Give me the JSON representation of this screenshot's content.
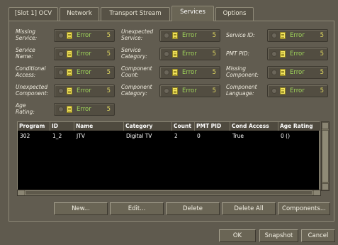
{
  "tabs": [
    {
      "label": "[Slot 1] OCV"
    },
    {
      "label": "Network"
    },
    {
      "label": "Transport Stream"
    },
    {
      "label": "Services"
    },
    {
      "label": "Options"
    }
  ],
  "active_tab": "Services",
  "status_items": [
    {
      "label": "Missing\nService:",
      "status": "Error",
      "count": "5"
    },
    {
      "label": "Unexpected\nService:",
      "status": "Error",
      "count": "5"
    },
    {
      "label": "Service ID:",
      "status": "Error",
      "count": "5"
    },
    {
      "label": "Service\nName:",
      "status": "Error",
      "count": "5"
    },
    {
      "label": "Service\nCategory:",
      "status": "Error",
      "count": "5"
    },
    {
      "label": "PMT PID:",
      "status": "Error",
      "count": "5"
    },
    {
      "label": "Conditional\nAccess:",
      "status": "Error",
      "count": "5"
    },
    {
      "label": "Component\nCount:",
      "status": "Error",
      "count": "5"
    },
    {
      "label": "Missing\nComponent:",
      "status": "Error",
      "count": "5"
    },
    {
      "label": "Unexpected\nComponent:",
      "status": "Error",
      "count": "5"
    },
    {
      "label": "Component\nCategory:",
      "status": "Error",
      "count": "5"
    },
    {
      "label": "Component\nLanguage:",
      "status": "Error",
      "count": "5"
    },
    {
      "label": "Age\nRating:",
      "status": "Error",
      "count": "5"
    }
  ],
  "table": {
    "columns": [
      "Program",
      "ID",
      "Name",
      "Category",
      "Count",
      "PMT PID",
      "Cond Access",
      "Age Rating"
    ],
    "rows": [
      [
        "302",
        "1_2",
        "JTV",
        "Digital TV",
        "2",
        "0",
        "True",
        "0 ()"
      ]
    ]
  },
  "actions": {
    "new": "New...",
    "edit": "Edit...",
    "delete": "Delete",
    "delete_all": "Delete All",
    "components": "Components..."
  },
  "dialog": {
    "ok": "OK",
    "snapshot": "Snapshot",
    "cancel": "Cancel"
  },
  "colors": {
    "background": "#5f5a4e",
    "error_text": "#9fd45a",
    "count_text": "#e0d860",
    "table_bg": "#000000"
  }
}
